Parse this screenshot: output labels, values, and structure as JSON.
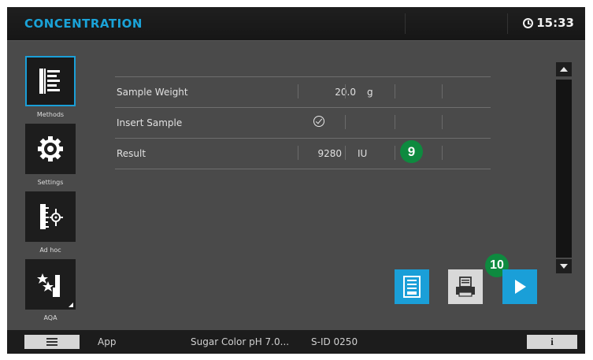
{
  "header": {
    "title": "CONCENTRATION",
    "time": "15:33"
  },
  "sidebar": {
    "items": [
      {
        "label": "Methods",
        "icon": "methods-list-icon"
      },
      {
        "label": "Settings",
        "icon": "gear-icon"
      },
      {
        "label": "Ad hoc",
        "icon": "adhoc-ruler-icon"
      },
      {
        "label": "AQA",
        "icon": "stars-bars-icon"
      }
    ]
  },
  "table": {
    "rows": [
      {
        "label": "Sample Weight",
        "value": "20.0",
        "unit": "g"
      },
      {
        "label": "Insert Sample",
        "value": "",
        "unit": "",
        "icon": "check-circle-icon"
      },
      {
        "label": "Result",
        "value": "9280",
        "unit": "IU"
      }
    ]
  },
  "badges": {
    "row_marker": "9",
    "action_marker": "10"
  },
  "actions": {
    "save": "save-icon",
    "print": "printer-icon",
    "start": "play-icon"
  },
  "footer": {
    "app_label": "App",
    "method_name": "Sugar Color pH 7.0...",
    "sample_id": "S-ID 0250",
    "info_label": "i"
  },
  "colors": {
    "accent": "#1aa3d8",
    "badge": "#0e8a3f",
    "background": "#4a4a4a"
  }
}
